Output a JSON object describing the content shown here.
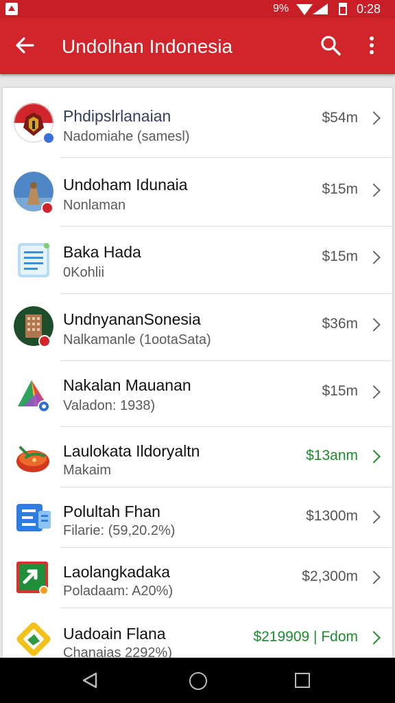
{
  "status_bar": {
    "indicator": "9%",
    "time": "0:28"
  },
  "app_bar": {
    "title": "Undolhan Indonesia",
    "back_icon": "arrow-back-icon",
    "search_icon": "search-icon",
    "more_icon": "more-vert-icon"
  },
  "colors": {
    "primary": "#d2252b",
    "green": "#1e8a2e",
    "text": "#111111",
    "secondary_text": "#5a5a5a"
  },
  "items": [
    {
      "title": "Phdipslrlanaian",
      "subtitle": "Nadomiahe (samesl)",
      "amount": "$54m",
      "amount_color": "gray",
      "icon": "garuda-icon"
    },
    {
      "title": "Undoham Idunaia",
      "subtitle": "Nonlaman",
      "amount": "$15m",
      "amount_color": "gray",
      "icon": "statue-photo-icon"
    },
    {
      "title": "Baka Hada",
      "subtitle": "0Kohlii",
      "amount": "$15m",
      "amount_color": "gray",
      "icon": "document-icon"
    },
    {
      "title": "UndnyananSonesia",
      "subtitle": "Nalkamanle (1ootaSata)",
      "amount": "$36m",
      "amount_color": "gray",
      "icon": "building-icon"
    },
    {
      "title": "Nakalan Mauanan",
      "subtitle": "Valadon: 1938)",
      "amount": "$15m",
      "amount_color": "gray",
      "icon": "play-triangle-icon"
    },
    {
      "title": "Laulokata Ildoryaltn",
      "subtitle": "Makaim",
      "amount": "$13anm",
      "amount_color": "green",
      "icon": "chili-icon"
    },
    {
      "title": "Polultah Fhan",
      "subtitle": "Filarie: (59,20.2%)",
      "amount": "$1300m",
      "amount_color": "gray",
      "icon": "blue-document-icon"
    },
    {
      "title": "Laolangkadaka",
      "subtitle": "Poladaam: A20%)",
      "amount": "$2,300m",
      "amount_color": "gray",
      "icon": "green-square-icon"
    },
    {
      "title": "Uadoain Flana",
      "subtitle": "Chanaias 2292%)",
      "amount": "$219909 | Fdom",
      "amount_color": "green",
      "icon": "yellow-diamond-icon"
    }
  ],
  "nav": {
    "back": "nav-back-icon",
    "home": "nav-home-icon",
    "recents": "nav-recents-icon"
  }
}
